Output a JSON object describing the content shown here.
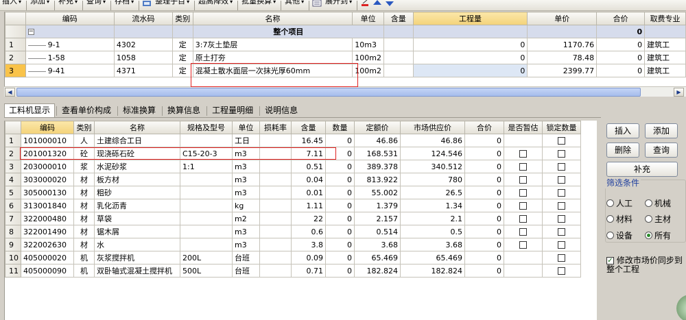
{
  "toolbar": {
    "items": [
      {
        "label": "插入",
        "dropdown": true
      },
      {
        "label": "添加",
        "dropdown": true
      },
      {
        "label": "补充",
        "dropdown": true
      },
      {
        "label": "查询",
        "dropdown": true
      },
      {
        "label": "存档",
        "dropdown": true
      },
      {
        "label": "整理子目",
        "dropdown": true
      },
      {
        "label": "超高降效",
        "dropdown": true
      },
      {
        "label": "批量换算",
        "dropdown": true
      },
      {
        "label": "其他",
        "dropdown": true
      },
      {
        "label": "展开到",
        "dropdown": true
      }
    ]
  },
  "top_grid": {
    "headers": [
      "编码",
      "流水码",
      "类别",
      "名称",
      "单位",
      "含量",
      "工程量",
      "单价",
      "合价",
      "取费专业"
    ],
    "group": {
      "toggle": "−",
      "title": "整个项目",
      "total": "0"
    },
    "rows": [
      {
        "rn": "1",
        "code": "9-1",
        "serial": "4302",
        "type": "定",
        "name": "3:7灰土垫层",
        "unit": "10m3",
        "content": "",
        "qty": "0",
        "price": "1170.76",
        "total": "0",
        "fee": "建筑工"
      },
      {
        "rn": "2",
        "code": "1-58",
        "serial": "1058",
        "type": "定",
        "name": "原土打夯",
        "unit": "100m2",
        "content": "",
        "qty": "0",
        "price": "78.48",
        "total": "0",
        "fee": "建筑工"
      },
      {
        "rn": "3",
        "code": "9-41",
        "serial": "4371",
        "type": "定",
        "name": "混凝土散水面层一次抹光厚60mm",
        "unit": "100m2",
        "content": "",
        "qty": "0",
        "price": "2399.77",
        "total": "0",
        "fee": "建筑工"
      }
    ]
  },
  "tabs": [
    "工料机显示",
    "查看单价构成",
    "标准换算",
    "换算信息",
    "工程量明细",
    "说明信息"
  ],
  "bottom_grid": {
    "headers": [
      "编码",
      "类别",
      "名称",
      "规格及型号",
      "单位",
      "损耗率",
      "含量",
      "数量",
      "定额价",
      "市场供应价",
      "合价",
      "是否暂估",
      "锁定数量"
    ],
    "rows": [
      {
        "rn": "1",
        "code": "101000010",
        "type": "人",
        "name": "土建综合工日",
        "spec": "",
        "unit": "工日",
        "loss": "",
        "content": "16.45",
        "qty": "0",
        "quota": "46.86",
        "market": "46.86",
        "total": "0",
        "est": false,
        "lock": true
      },
      {
        "rn": "2",
        "code": "201001320",
        "type": "砼",
        "name": "现浇砾石砼",
        "spec": "C15-20-3",
        "unit": "m3",
        "loss": "",
        "content": "7.11",
        "qty": "0",
        "quota": "168.531",
        "market": "124.546",
        "total": "0",
        "est": true,
        "lock": true
      },
      {
        "rn": "3",
        "code": "203000010",
        "type": "浆",
        "name": "水泥砂浆",
        "spec": "1:1",
        "unit": "m3",
        "loss": "",
        "content": "0.51",
        "qty": "0",
        "quota": "389.378",
        "market": "340.512",
        "total": "0",
        "est": true,
        "lock": true
      },
      {
        "rn": "4",
        "code": "303000020",
        "type": "材",
        "name": "板方材",
        "spec": "",
        "unit": "m3",
        "loss": "",
        "content": "0.04",
        "qty": "0",
        "quota": "813.922",
        "market": "780",
        "total": "0",
        "est": true,
        "lock": true
      },
      {
        "rn": "5",
        "code": "305000130",
        "type": "材",
        "name": "粗砂",
        "spec": "",
        "unit": "m3",
        "loss": "",
        "content": "0.01",
        "qty": "0",
        "quota": "55.002",
        "market": "26.5",
        "total": "0",
        "est": true,
        "lock": true
      },
      {
        "rn": "6",
        "code": "313001840",
        "type": "材",
        "name": "乳化沥青",
        "spec": "",
        "unit": "kg",
        "loss": "",
        "content": "1.11",
        "qty": "0",
        "quota": "1.379",
        "market": "1.34",
        "total": "0",
        "est": true,
        "lock": true
      },
      {
        "rn": "7",
        "code": "322000480",
        "type": "材",
        "name": "草袋",
        "spec": "",
        "unit": "m2",
        "loss": "",
        "content": "22",
        "qty": "0",
        "quota": "2.157",
        "market": "2.1",
        "total": "0",
        "est": true,
        "lock": true
      },
      {
        "rn": "8",
        "code": "322001490",
        "type": "材",
        "name": "锯木屑",
        "spec": "",
        "unit": "m3",
        "loss": "",
        "content": "0.6",
        "qty": "0",
        "quota": "0.514",
        "market": "0.5",
        "total": "0",
        "est": true,
        "lock": true
      },
      {
        "rn": "9",
        "code": "322002630",
        "type": "材",
        "name": "水",
        "spec": "",
        "unit": "m3",
        "loss": "",
        "content": "3.8",
        "qty": "0",
        "quota": "3.68",
        "market": "3.68",
        "total": "0",
        "est": true,
        "lock": true
      },
      {
        "rn": "10",
        "code": "405000020",
        "type": "机",
        "name": "灰浆搅拌机",
        "spec": "200L",
        "unit": "台班",
        "loss": "",
        "content": "0.09",
        "qty": "0",
        "quota": "65.469",
        "market": "65.469",
        "total": "0",
        "est": false,
        "lock": true
      },
      {
        "rn": "11",
        "code": "405000090",
        "type": "机",
        "name": "双卧轴式混凝土搅拌机",
        "spec": "500L",
        "unit": "台班",
        "loss": "",
        "content": "0.71",
        "qty": "0",
        "quota": "182.824",
        "market": "182.824",
        "total": "0",
        "est": false,
        "lock": true
      }
    ]
  },
  "panel": {
    "insert": "插入",
    "add": "添加",
    "delete": "删除",
    "query": "查询",
    "supplement": "补充",
    "filter_title": "筛选条件",
    "filters": [
      {
        "label": "人工",
        "checked": false
      },
      {
        "label": "机械",
        "checked": false
      },
      {
        "label": "材料",
        "checked": false
      },
      {
        "label": "主材",
        "checked": false
      },
      {
        "label": "设备",
        "checked": false
      },
      {
        "label": "所有",
        "checked": true
      }
    ],
    "sync_label": "修改市场价同步到整个工程",
    "sync_checked": true
  }
}
